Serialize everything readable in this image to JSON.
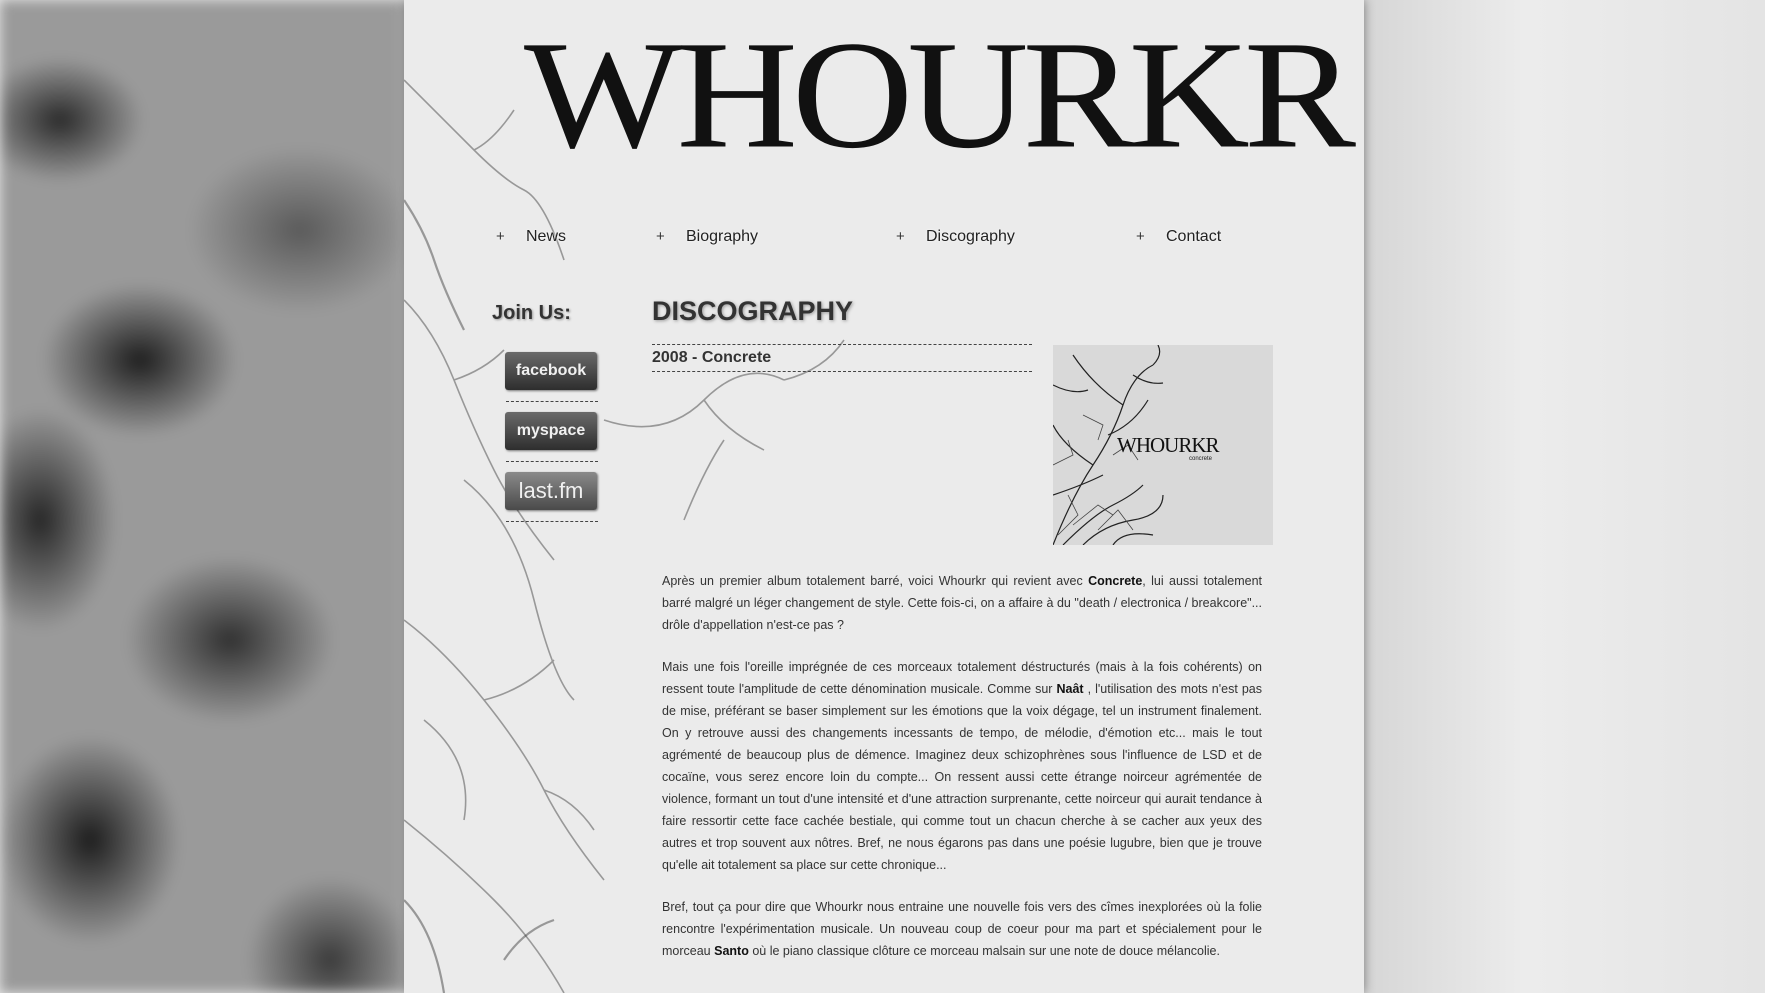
{
  "logo": {
    "text": "WHOURKR"
  },
  "nav": {
    "plus": "+",
    "items": [
      {
        "label": "News"
      },
      {
        "label": "Biography"
      },
      {
        "label": "Discography"
      },
      {
        "label": "Contact"
      }
    ]
  },
  "sidebar": {
    "title": "Join Us:",
    "social": [
      {
        "label": "facebook"
      },
      {
        "label": "myspace"
      },
      {
        "label": "last.fm"
      }
    ]
  },
  "main": {
    "title": "DISCOGRAPHY",
    "album_title": "2008 - Concrete",
    "cover": {
      "band": "WHOURKR",
      "album": "concrete"
    },
    "p1": {
      "a": "Après un premier album totalement barré, voici Whourkr qui revient avec ",
      "b": "Concrete",
      "c": ", lui aussi totalement barré malgré un léger changement de style. Cette fois-ci, on a affaire à du \"death / electronica / breakcore\"... drôle d'appellation n'est-ce pas ?"
    },
    "p2": {
      "a": "Mais une fois l'oreille imprégnée de ces morceaux totalement déstructurés (mais à la fois cohérents) on ressent toute l'amplitude de cette dénomination musicale. Comme sur ",
      "b": "Naât",
      "c": " , l'utilisation des mots n'est pas de mise, préférant se baser simplement sur les émotions que la voix dégage, tel un instrument finalement. On y retrouve aussi des changements incessants de tempo, de mélodie, d'émotion etc... mais le tout agrémenté de beaucoup plus de démence. Imaginez deux schizophrènes sous l'influence de LSD et de cocaïne, vous serez encore loin du compte... On ressent aussi cette étrange noirceur agrémentée de violence, formant un tout d'une intensité et d'une attraction surprenante, cette noirceur qui aurait tendance à faire ressortir cette face cachée bestiale, qui comme tout un chacun cherche à se cacher aux yeux des autres et trop souvent aux nôtres. Bref, ne nous égarons pas dans une poésie lugubre, bien que je trouve qu'elle ait totalement sa place sur cette chronique..."
    },
    "p3": {
      "a": "Bref, tout ça pour dire que Whourkr nous entraine une nouvelle fois vers des cîmes inexplorées où la folie rencontre l'expérimentation musicale. Un nouveau coup de coeur pour ma part et spécialement pour le morceau ",
      "b": "Santo",
      "c": " où le piano classique clôture ce morceau malsain sur une note de douce mélancolie."
    }
  }
}
